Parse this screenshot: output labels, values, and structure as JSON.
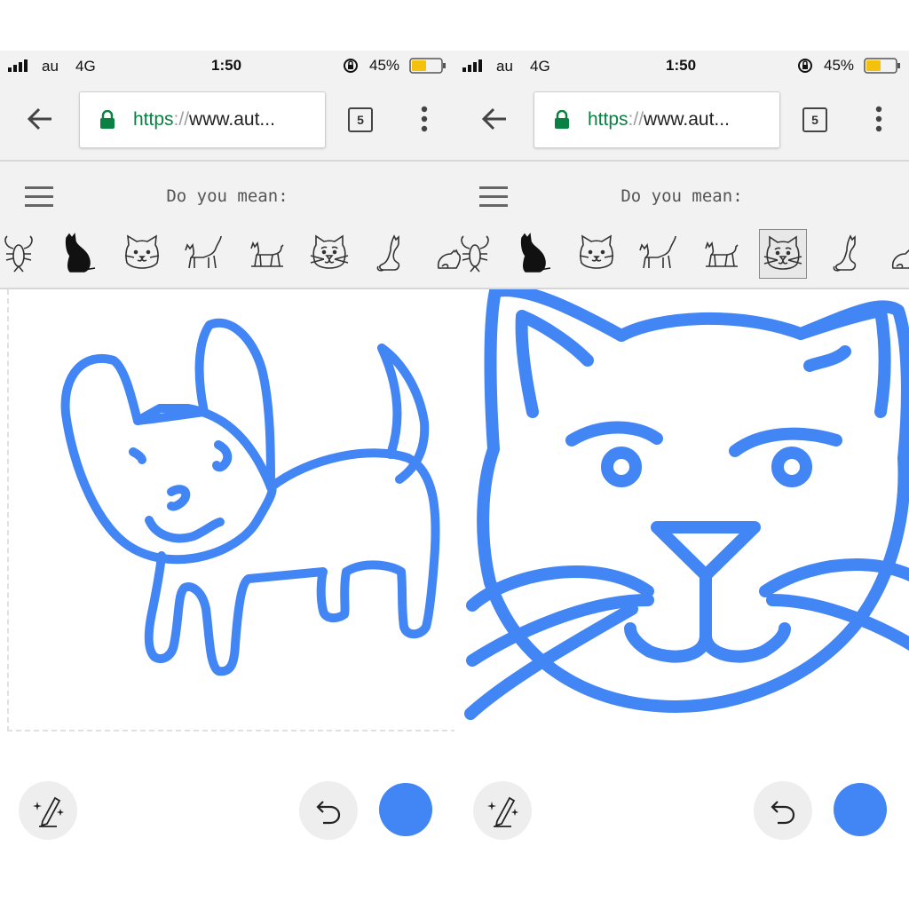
{
  "status_bar": {
    "carrier": "au",
    "network": "4G",
    "time": "1:50",
    "battery": "45%"
  },
  "browser": {
    "url_scheme": "https",
    "url_sep": "://",
    "url_rest": "www.aut...",
    "tab_count": "5"
  },
  "app": {
    "prompt": "Do you mean:"
  },
  "colors": {
    "stroke": "#4285f4",
    "chrome_bg": "#f2f2f2",
    "secure_green": "#0b8043",
    "battery_fill": "#f4c20d"
  },
  "icons": {
    "status": [
      "signal-bars-icon",
      "rotation-lock-icon",
      "battery-icon"
    ],
    "toolbar": [
      "back-arrow-icon",
      "padlock-icon",
      "tab-switcher-icon",
      "overflow-menu-icon",
      "hamburger-icon"
    ],
    "bottom": [
      "autodraw-pencil-sparkle-icon",
      "undo-icon",
      "color-picker-dot"
    ]
  },
  "suggestions": [
    {
      "name": "lobster"
    },
    {
      "name": "cat-silhouette"
    },
    {
      "name": "cat-face"
    },
    {
      "name": "walking-cat"
    },
    {
      "name": "cat-small"
    },
    {
      "name": "cat-face-whiskers"
    },
    {
      "name": "sitting-cat"
    },
    {
      "name": "cat-curled"
    }
  ],
  "panels": [
    {
      "name": "left-screen",
      "selected_suggestion": null
    },
    {
      "name": "right-screen",
      "selected_suggestion": "cat-face-whiskers"
    }
  ]
}
